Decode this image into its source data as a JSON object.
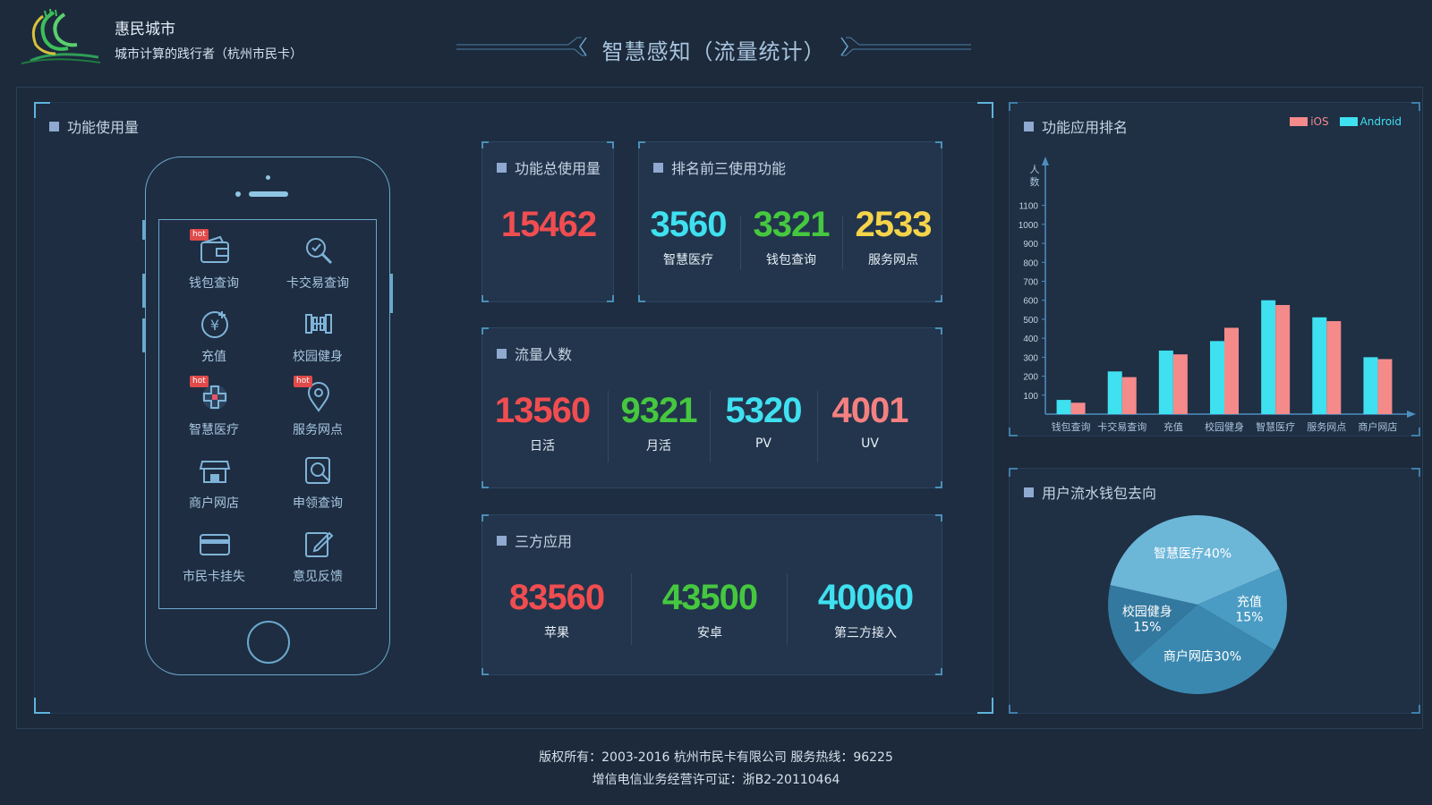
{
  "header": {
    "brand_name": "惠民城市",
    "slogan": "城市计算的践行者（杭州市民卡）",
    "title": "智慧感知（流量统计）"
  },
  "usage_panel": {
    "title": "功能使用量",
    "apps": [
      {
        "label": "钱包查询",
        "icon": "wallet-icon",
        "hot": true
      },
      {
        "label": "卡交易查询",
        "icon": "search-transaction-icon",
        "hot": false
      },
      {
        "label": "充值",
        "icon": "recharge-icon",
        "hot": false
      },
      {
        "label": "校园健身",
        "icon": "dumbbell-icon",
        "hot": false
      },
      {
        "label": "智慧医疗",
        "icon": "medical-cross-icon",
        "hot": true
      },
      {
        "label": "服务网点",
        "icon": "location-pin-icon",
        "hot": true
      },
      {
        "label": "商户网店",
        "icon": "shop-icon",
        "hot": false
      },
      {
        "label": "申领查询",
        "icon": "apply-search-icon",
        "hot": false
      },
      {
        "label": "市民卡挂失",
        "icon": "card-icon",
        "hot": false
      },
      {
        "label": "意见反馈",
        "icon": "feedback-icon",
        "hot": false
      }
    ],
    "hot_badge": "hot"
  },
  "total_usage": {
    "title": "功能总使用量",
    "value": "15462"
  },
  "top3": {
    "title": "排名前三使用功能",
    "items": [
      {
        "value": "3560",
        "label": "智慧医疗",
        "color": "#3fe0f0"
      },
      {
        "value": "3321",
        "label": "钱包查询",
        "color": "#45c83f"
      },
      {
        "value": "2533",
        "label": "服务网点",
        "color": "#f5d44a"
      }
    ]
  },
  "traffic": {
    "title": "流量人数",
    "items": [
      {
        "value": "13560",
        "label": "日活",
        "color": "#f14d50"
      },
      {
        "value": "9321",
        "label": "月活",
        "color": "#45c83f"
      },
      {
        "value": "5320",
        "label": "PV",
        "color": "#3fe0f0"
      },
      {
        "value": "4001",
        "label": "UV",
        "color": "#f58080"
      }
    ]
  },
  "third_party": {
    "title": "三方应用",
    "items": [
      {
        "value": "83560",
        "label": "苹果",
        "color": "#f14d50"
      },
      {
        "value": "43500",
        "label": "安卓",
        "color": "#45c83f"
      },
      {
        "value": "40060",
        "label": "第三方接入",
        "color": "#3fe0f0"
      }
    ]
  },
  "rank_panel": {
    "title": "功能应用排名"
  },
  "pie_panel": {
    "title": "用户流水钱包去向"
  },
  "chart_data": [
    {
      "type": "bar",
      "title": "功能应用排名",
      "ylabel": "人数",
      "categories": [
        "钱包查询",
        "卡交易查询",
        "充值",
        "校园健身",
        "智慧医疗",
        "服务网点",
        "商户网店"
      ],
      "yticks": [
        100,
        200,
        300,
        400,
        500,
        600,
        700,
        800,
        900,
        1000,
        1100
      ],
      "ylim": [
        0,
        1150
      ],
      "series": [
        {
          "name": "Android",
          "color": "#3fe0f0",
          "values": [
            75,
            225,
            335,
            385,
            600,
            510,
            300
          ]
        },
        {
          "name": "iOS",
          "color": "#f58a8a",
          "values": [
            60,
            195,
            315,
            455,
            575,
            490,
            290
          ]
        }
      ],
      "legend": "top-right"
    },
    {
      "type": "pie",
      "title": "用户流水钱包去向",
      "slices": [
        {
          "label": "智慧医疗",
          "pct": "40%",
          "value": 40,
          "color": "#6cb6d8"
        },
        {
          "label": "充值",
          "pct": "15%",
          "value": 15,
          "color": "#4a9cc4"
        },
        {
          "label": "商户网店",
          "pct": "30%",
          "value": 30,
          "color": "#3a88b0"
        },
        {
          "label": "校园健身",
          "pct": "15%",
          "value": 15,
          "color": "#33789e"
        }
      ]
    }
  ],
  "footer": {
    "line1": "版权所有：2003-2016  杭州市民卡有限公司  服务热线：96225",
    "line2": "增信电信业务经营许可证：浙B2-20110464"
  }
}
